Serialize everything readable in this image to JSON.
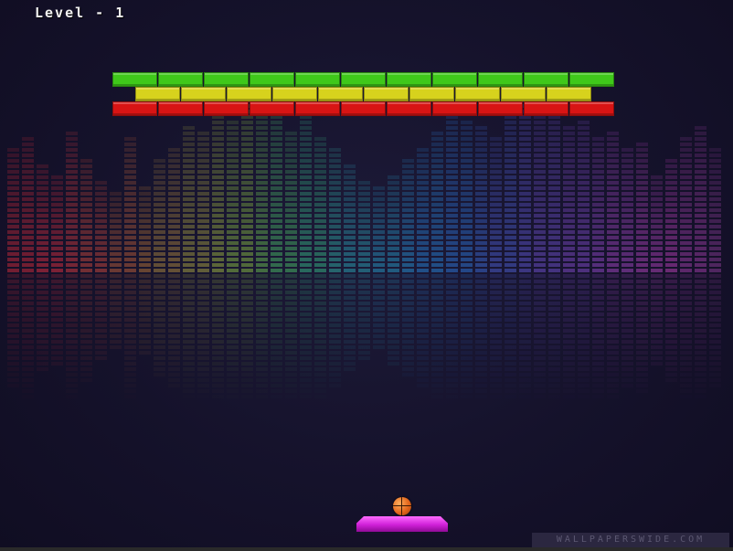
{
  "hud": {
    "level_text": "Level - 1"
  },
  "bricks": {
    "rows": [
      {
        "name": "green-row",
        "count": 11,
        "color": "#3fc81a"
      },
      {
        "name": "yellow-row",
        "count": 10,
        "color": "#d7d21d"
      },
      {
        "name": "red-row",
        "count": 11,
        "color": "#d81414"
      }
    ]
  },
  "ball": {
    "icon": "basketball-icon",
    "color": "#e2661c"
  },
  "paddle": {
    "color": "#d020d8"
  },
  "watermark": {
    "text": "WALLPAPERSWIDE.COM"
  }
}
